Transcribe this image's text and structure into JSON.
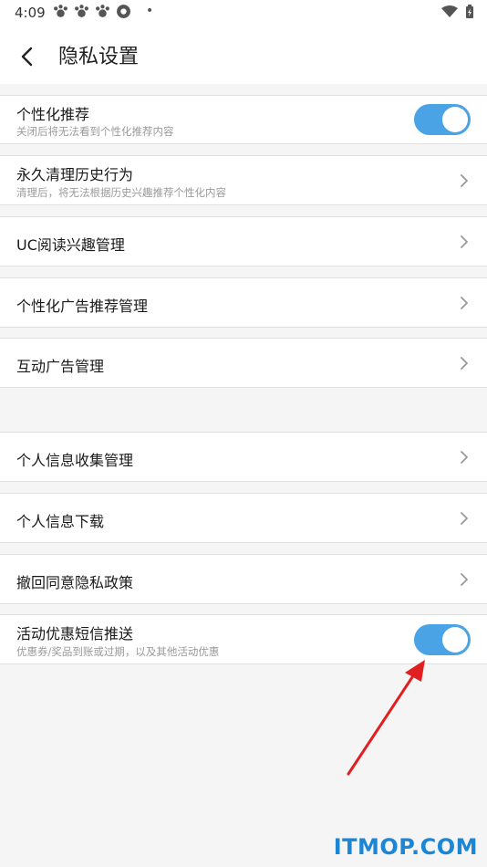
{
  "status_bar": {
    "time": "4:09",
    "dot": "•"
  },
  "header": {
    "title": "隐私设置"
  },
  "settings": [
    {
      "title": "个性化推荐",
      "subtitle": "关闭后将无法看到个性化推荐内容",
      "control": "toggle",
      "on": true
    },
    {
      "title": "永久清理历史行为",
      "subtitle": "清理后，将无法根据历史兴趣推荐个性化内容",
      "control": "chevron"
    },
    {
      "title": "UC阅读兴趣管理",
      "control": "chevron"
    },
    {
      "title": "个性化广告推荐管理",
      "control": "chevron"
    },
    {
      "title": "互动广告管理",
      "control": "chevron"
    },
    {
      "title": "个人信息收集管理",
      "control": "chevron"
    },
    {
      "title": "个人信息下载",
      "control": "chevron"
    },
    {
      "title": "撤回同意隐私政策",
      "control": "chevron"
    },
    {
      "title": "活动优惠短信推送",
      "subtitle": "优惠券/奖品到账或过期，以及其他活动优惠",
      "control": "toggle",
      "on": true
    }
  ],
  "colors": {
    "accent": "#4aa3e5",
    "annotation_arrow": "#e02020",
    "watermark": "#1b86d6"
  },
  "watermark": "ITMOP.COM"
}
